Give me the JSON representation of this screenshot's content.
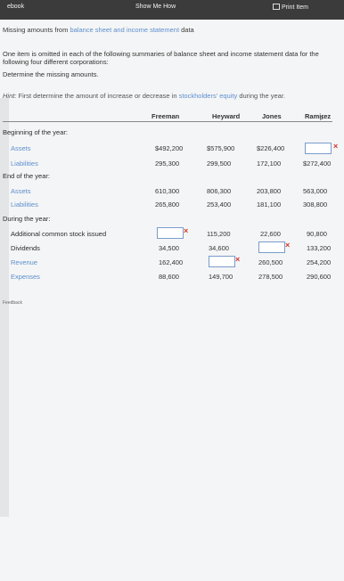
{
  "toolbar": {
    "ebook": "ebook",
    "show_me_how": "Show Me How",
    "print_item": "Print Item"
  },
  "title": {
    "prefix": "Missing amounts from ",
    "link": "balance sheet and income statement",
    "suffix": " data"
  },
  "intro": "One item is omitted in each of the following summaries of balance sheet and income statement data for the following four different corporations:",
  "instruction": "Determine the missing amounts.",
  "hint": {
    "label": "Hint:",
    "text1": " First determine the amount of increase or decrease in ",
    "link": "stockholders' equity",
    "text2": " during the year."
  },
  "columns": [
    "Freeman",
    "Heyward",
    "Jones",
    "Ramirez"
  ],
  "section_begin": "Beginning of the year:",
  "section_end": "End of the year:",
  "section_during": "During the year:",
  "rows": {
    "begin_assets": {
      "label": "Assets",
      "values": [
        "$492,200",
        "$575,900",
        "$226,400",
        ""
      ]
    },
    "begin_liabilities": {
      "label": "Liabilities",
      "values": [
        "295,300",
        "299,500",
        "172,100",
        "$272,400"
      ]
    },
    "end_assets": {
      "label": "Assets",
      "values": [
        "610,300",
        "806,300",
        "203,800",
        "563,000"
      ]
    },
    "end_liabilities": {
      "label": "Liabilities",
      "values": [
        "265,800",
        "253,400",
        "181,100",
        "308,800"
      ]
    },
    "additional_stock": {
      "label": "Additional common stock issued",
      "values": [
        "",
        "115,200",
        "22,600",
        "90,800"
      ]
    },
    "dividends": {
      "label": "Dividends",
      "values": [
        "34,500",
        "34,600",
        "",
        "133,200"
      ]
    },
    "revenue": {
      "label": "Revenue",
      "values": [
        "162,400",
        "",
        "260,500",
        "254,200"
      ]
    },
    "expenses": {
      "label": "Expenses",
      "values": [
        "88,600",
        "149,700",
        "278,500",
        "290,600"
      ]
    }
  },
  "sidebar": {
    "feedback": "Feedback"
  }
}
